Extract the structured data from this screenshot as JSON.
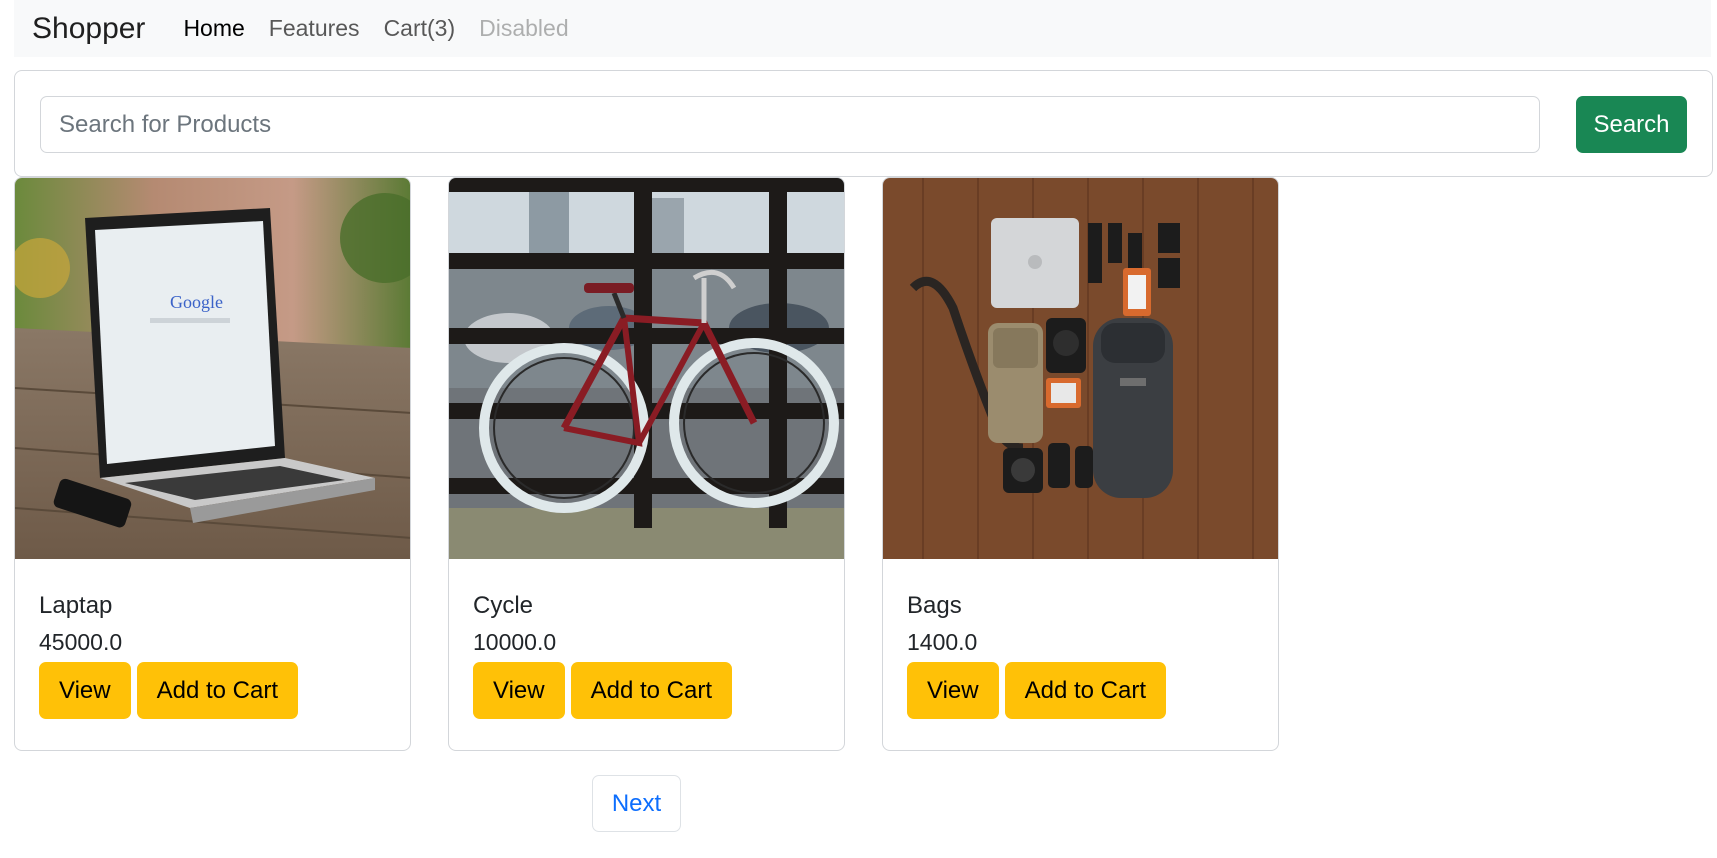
{
  "navbar": {
    "brand": "Shopper",
    "links": [
      {
        "label": "Home",
        "state": "active"
      },
      {
        "label": "Features",
        "state": "normal"
      },
      {
        "label": "Cart(3)",
        "state": "normal"
      },
      {
        "label": "Disabled",
        "state": "disabled"
      }
    ]
  },
  "search": {
    "placeholder": "Search for Products",
    "value": "",
    "button_label": "Search"
  },
  "products": [
    {
      "name": "Laptap",
      "price": "45000.0",
      "image": "laptop-photo",
      "view_label": "View",
      "add_label": "Add to Cart"
    },
    {
      "name": "Cycle",
      "price": "10000.0",
      "image": "bicycle-photo",
      "view_label": "View",
      "add_label": "Add to Cart"
    },
    {
      "name": "Bags",
      "price": "1400.0",
      "image": "bag-gear-photo",
      "view_label": "View",
      "add_label": "Add to Cart"
    }
  ],
  "pagination": {
    "next_label": "Next"
  },
  "colors": {
    "navbar_bg": "#f8f9fa",
    "search_button": "#198754",
    "card_button": "#ffc107",
    "link_blue": "#0d6efd"
  }
}
